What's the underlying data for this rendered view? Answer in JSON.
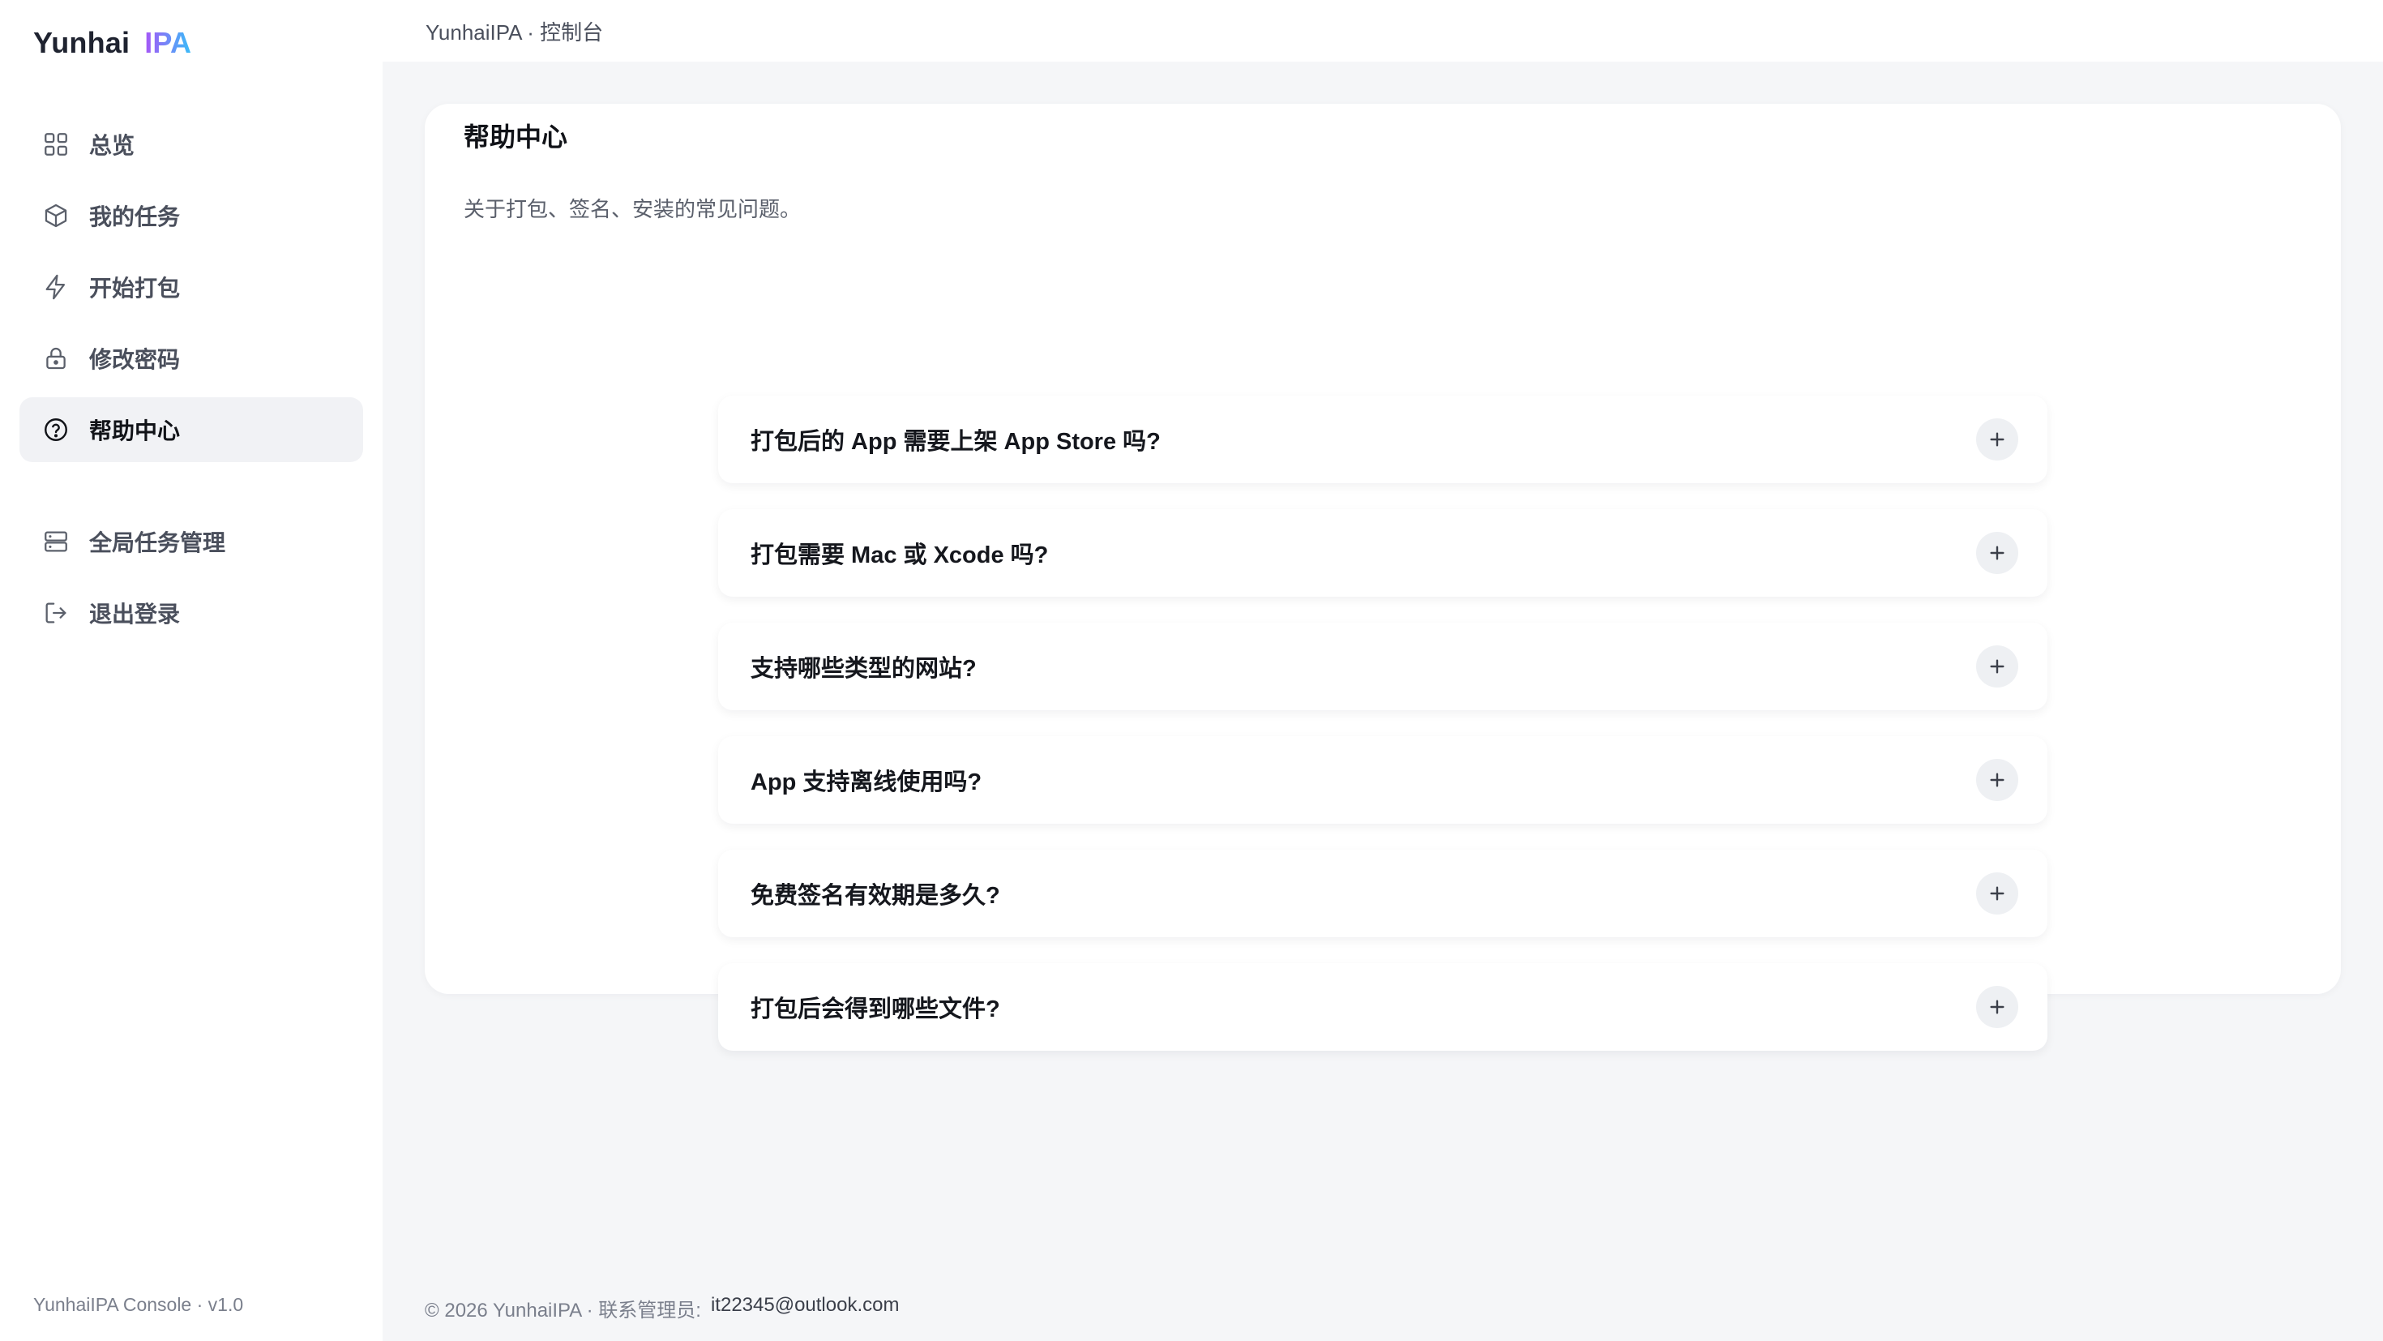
{
  "brand": {
    "name": "Yunhai",
    "suffix": "IPA"
  },
  "breadcrumb": "YunhaiIPA · 控制台",
  "nav": {
    "items": [
      {
        "label": "总览",
        "icon": "grid-icon",
        "active": false
      },
      {
        "label": "我的任务",
        "icon": "box-icon",
        "active": false
      },
      {
        "label": "开始打包",
        "icon": "bolt-icon",
        "active": false
      },
      {
        "label": "修改密码",
        "icon": "lock-icon",
        "active": false
      },
      {
        "label": "帮助中心",
        "icon": "help-circle-icon",
        "active": true
      },
      {
        "label": "全局任务管理",
        "icon": "server-icon",
        "active": false
      },
      {
        "label": "退出登录",
        "icon": "logout-icon",
        "active": false
      }
    ]
  },
  "sidebar_footer": "YunhaiIPA Console · v1.0",
  "help": {
    "title": "帮助中心",
    "subtitle": "关于打包、签名、安装的常见问题。",
    "faqs": [
      "打包后的 App 需要上架 App Store 吗?",
      "打包需要 Mac 或 Xcode 吗?",
      "支持哪些类型的网站?",
      "App 支持离线使用吗?",
      "免费签名有效期是多久?",
      "打包后会得到哪些文件?"
    ]
  },
  "footer": {
    "text": "© 2026 YunhaiIPA · 联系管理员:",
    "email": "it22345@outlook.com"
  }
}
